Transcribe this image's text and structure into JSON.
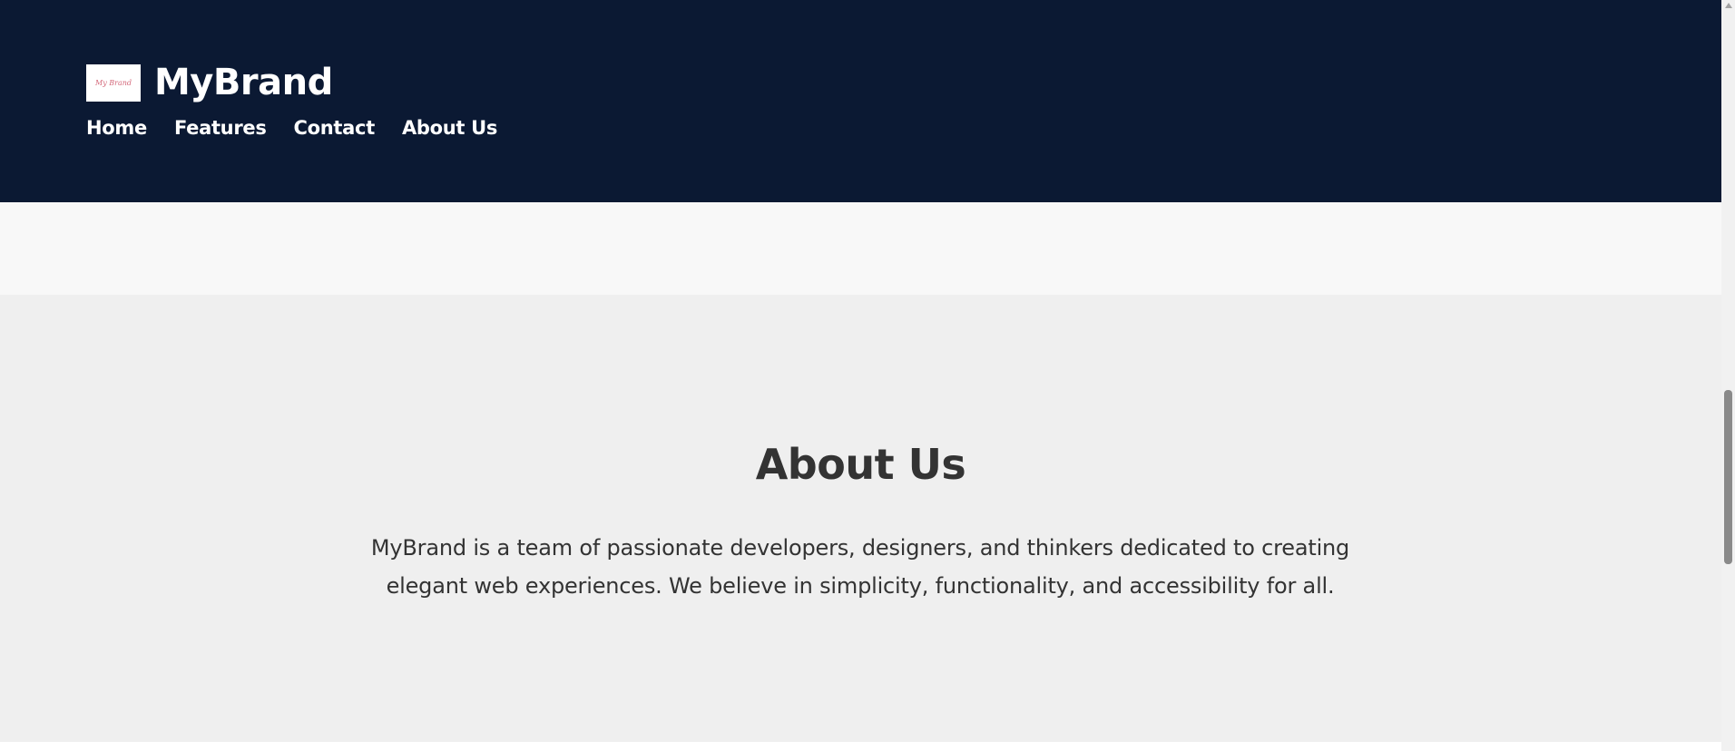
{
  "header": {
    "logo_text": "My Brand",
    "brand_name": "MyBrand",
    "nav": [
      "Home",
      "Features",
      "Contact",
      "About Us"
    ]
  },
  "about": {
    "title": "About Us",
    "text": "MyBrand is a team of passionate developers, designers, and thinkers dedicated to creating elegant web experiences. We believe in simplicity, functionality, and accessibility for all."
  },
  "colors": {
    "header_bg": "#0b1933",
    "section_bg": "#efefef",
    "text": "#333333"
  }
}
